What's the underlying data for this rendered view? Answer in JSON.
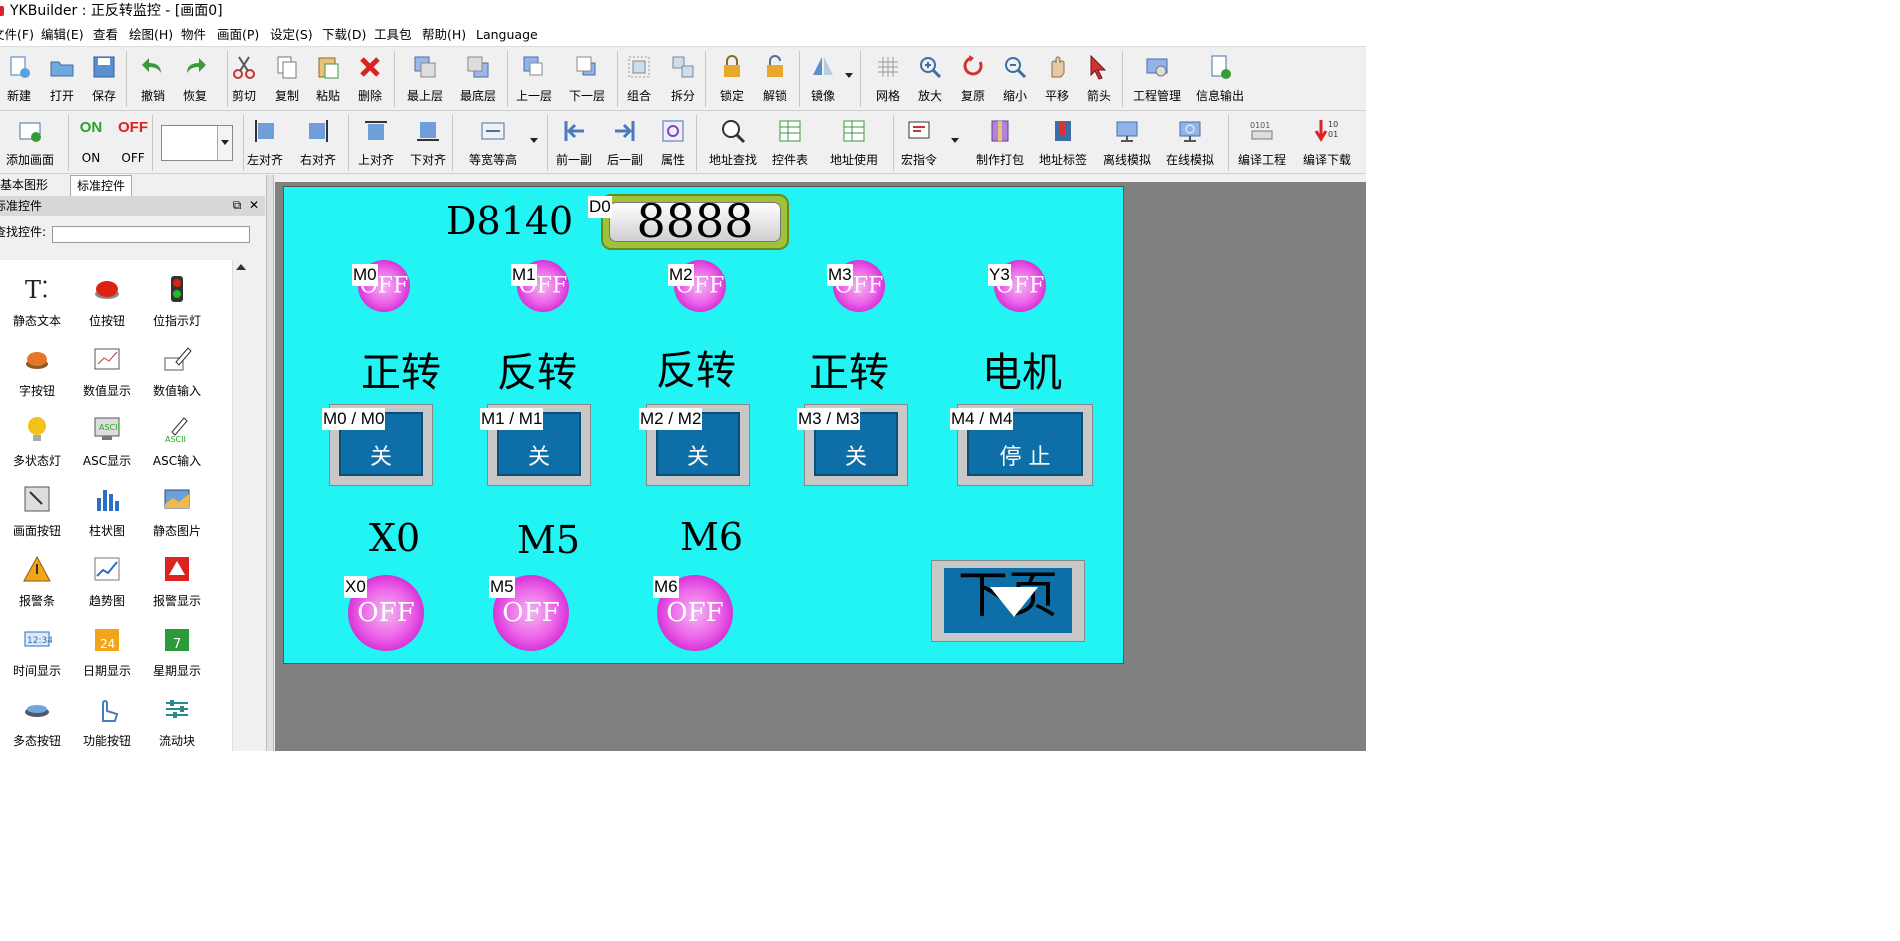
{
  "window": {
    "title": "YKBuilder : 正反转监控 - [画面0]"
  },
  "menu": [
    "文件(F)",
    "编辑(E)",
    "查看",
    "绘图(H)",
    "物件",
    "画面(P)",
    "设定(S)",
    "下载(D)",
    "工具包",
    "帮助(H)",
    "Language"
  ],
  "toolbar1": [
    {
      "label": "新建",
      "icon": "new-icon"
    },
    {
      "label": "打开",
      "icon": "open-folder-icon"
    },
    {
      "label": "保存",
      "icon": "save-icon"
    },
    {
      "label": "撤销",
      "icon": "undo-icon"
    },
    {
      "label": "恢复",
      "icon": "redo-icon"
    },
    {
      "label": "剪切",
      "icon": "cut-icon"
    },
    {
      "label": "复制",
      "icon": "copy-icon"
    },
    {
      "label": "粘贴",
      "icon": "paste-icon"
    },
    {
      "label": "删除",
      "icon": "delete-icon"
    },
    {
      "label": "最上层",
      "icon": "bring-to-front-icon"
    },
    {
      "label": "最底层",
      "icon": "send-to-back-icon"
    },
    {
      "label": "上一层",
      "icon": "bring-forward-icon"
    },
    {
      "label": "下一层",
      "icon": "send-backward-icon"
    },
    {
      "label": "组合",
      "icon": "group-icon"
    },
    {
      "label": "拆分",
      "icon": "ungroup-icon"
    },
    {
      "label": "锁定",
      "icon": "lock-icon"
    },
    {
      "label": "解锁",
      "icon": "unlock-icon"
    },
    {
      "label": "镜像",
      "icon": "mirror-icon"
    },
    {
      "label": "网格",
      "icon": "grid-icon"
    },
    {
      "label": "放大",
      "icon": "zoom-in-icon"
    },
    {
      "label": "复原",
      "icon": "restore-icon"
    },
    {
      "label": "缩小",
      "icon": "zoom-out-icon"
    },
    {
      "label": "平移",
      "icon": "pan-hand-icon"
    },
    {
      "label": "箭头",
      "icon": "arrow-pointer-icon"
    },
    {
      "label": "工程管理",
      "icon": "project-manager-icon"
    },
    {
      "label": "信息输出",
      "icon": "info-output-icon"
    }
  ],
  "toolbar2": [
    {
      "label": "添加画面",
      "icon": "add-screen-icon"
    },
    {
      "label": "ON",
      "icon": "on-text-icon",
      "text": "ON"
    },
    {
      "label": "OFF",
      "icon": "off-text-icon",
      "text": "OFF"
    },
    {
      "label": "左对齐",
      "icon": "align-left-icon"
    },
    {
      "label": "右对齐",
      "icon": "align-right-icon"
    },
    {
      "label": "上对齐",
      "icon": "align-top-icon"
    },
    {
      "label": "下对齐",
      "icon": "align-bottom-icon"
    },
    {
      "label": "等宽等高",
      "icon": "same-size-icon"
    },
    {
      "label": "前一副",
      "icon": "previous-screen-icon"
    },
    {
      "label": "后一副",
      "icon": "next-screen-icon"
    },
    {
      "label": "属性",
      "icon": "properties-icon"
    },
    {
      "label": "地址查找",
      "icon": "address-search-icon"
    },
    {
      "label": "控件表",
      "icon": "control-table-icon"
    },
    {
      "label": "地址使用",
      "icon": "address-usage-icon"
    },
    {
      "label": "宏指令",
      "icon": "macro-icon"
    },
    {
      "label": "制作打包",
      "icon": "package-icon"
    },
    {
      "label": "地址标签",
      "icon": "address-tag-icon"
    },
    {
      "label": "离线模拟",
      "icon": "offline-sim-icon"
    },
    {
      "label": "在线模拟",
      "icon": "online-sim-icon"
    },
    {
      "label": "编译工程",
      "icon": "compile-icon"
    },
    {
      "label": "编译下载",
      "icon": "compile-download-icon"
    }
  ],
  "panel": {
    "tabs": [
      "基本图形",
      "标准控件"
    ],
    "active_tab": 1,
    "header": "标准控件",
    "search_label": "查找控件:",
    "search_value": "",
    "items": [
      {
        "label": "静态文本",
        "icon": "static-text-icon"
      },
      {
        "label": "位按钮",
        "icon": "bit-button-icon"
      },
      {
        "label": "位指示灯",
        "icon": "bit-indicator-light-icon"
      },
      {
        "label": "字按钮",
        "icon": "word-button-icon"
      },
      {
        "label": "数值显示",
        "icon": "numeric-display-icon"
      },
      {
        "label": "数值输入",
        "icon": "numeric-input-icon"
      },
      {
        "label": "多状态灯",
        "icon": "multi-state-lamp-icon"
      },
      {
        "label": "ASC显示",
        "icon": "ascii-display-icon"
      },
      {
        "label": "ASC输入",
        "icon": "ascii-input-icon"
      },
      {
        "label": "画面按钮",
        "icon": "screen-button-icon"
      },
      {
        "label": "柱状图",
        "icon": "bar-chart-icon"
      },
      {
        "label": "静态图片",
        "icon": "static-picture-icon"
      },
      {
        "label": "报警条",
        "icon": "alarm-bar-icon"
      },
      {
        "label": "趋势图",
        "icon": "trend-chart-icon"
      },
      {
        "label": "报警显示",
        "icon": "alarm-display-icon"
      },
      {
        "label": "时间显示",
        "icon": "time-display-icon"
      },
      {
        "label": "日期显示",
        "icon": "date-display-icon"
      },
      {
        "label": "星期显示",
        "icon": "weekday-display-icon"
      },
      {
        "label": "多态按钮",
        "icon": "multi-state-button-icon"
      },
      {
        "label": "功能按钮",
        "icon": "function-button-icon"
      },
      {
        "label": "流动块",
        "icon": "flow-block-icon"
      }
    ]
  },
  "screen": {
    "background": "#22f4f4",
    "display_label": "D8140",
    "display_tag": "D0",
    "display_value": "8888",
    "lamps_top": [
      {
        "tag": "M0",
        "text": "OFF"
      },
      {
        "tag": "M1",
        "text": "OFF"
      },
      {
        "tag": "M2",
        "text": "OFF"
      },
      {
        "tag": "M3",
        "text": "OFF"
      },
      {
        "tag": "Y3",
        "text": "OFF"
      }
    ],
    "labels": [
      "正转",
      "反转",
      "反转",
      "正转",
      "电机"
    ],
    "buttons": [
      {
        "tag": "M0 / M0",
        "text": "关"
      },
      {
        "tag": "M1 / M1",
        "text": "关"
      },
      {
        "tag": "M2 / M2",
        "text": "关"
      },
      {
        "tag": "M3 / M3",
        "text": "关"
      },
      {
        "tag": "M4 / M4",
        "text": "停 止"
      }
    ],
    "bottom_labels": [
      "X0",
      "M5",
      "M6"
    ],
    "lamps_bottom": [
      {
        "tag": "X0",
        "text": "OFF"
      },
      {
        "tag": "M5",
        "text": "OFF"
      },
      {
        "tag": "M6",
        "text": "OFF"
      }
    ],
    "next_page_text": "下页"
  },
  "colors": {
    "lamp": "#ee66ea",
    "button_face": "#0e6fa8",
    "display_frame": "#9ec33a",
    "workspace": "#808080"
  }
}
